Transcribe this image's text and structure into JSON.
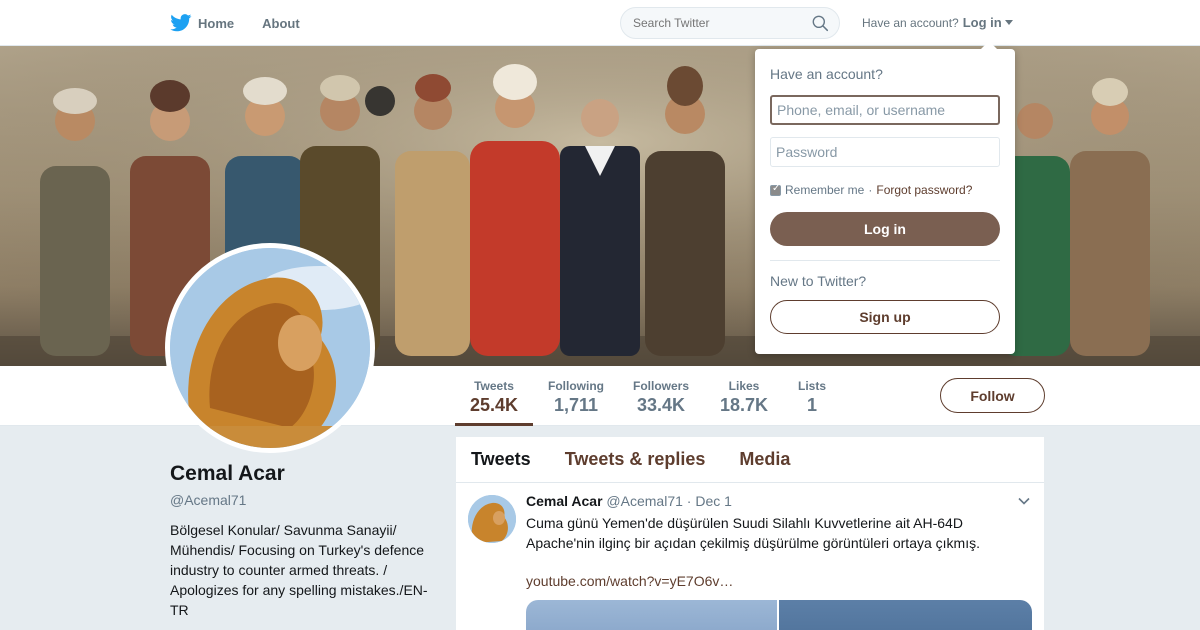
{
  "nav": {
    "home_label": "Home",
    "about_label": "About",
    "search_placeholder": "Search Twitter",
    "have_account_text": "Have an account?",
    "login_label": "Log in"
  },
  "profile": {
    "name": "Cemal Acar",
    "handle": "@Acemal71",
    "bio": "Bölgesel Konular/ Savunma Sanayii/ Mühendis/ Focusing on Turkey's defence industry to counter armed threats. / Apologizes for any spelling mistakes./EN-TR"
  },
  "stats": [
    {
      "label": "Tweets",
      "value": "25.4K"
    },
    {
      "label": "Following",
      "value": "1,711"
    },
    {
      "label": "Followers",
      "value": "33.4K"
    },
    {
      "label": "Likes",
      "value": "18.7K"
    },
    {
      "label": "Lists",
      "value": "1"
    }
  ],
  "follow_label": "Follow",
  "timeline": {
    "tabs": [
      "Tweets",
      "Tweets & replies",
      "Media"
    ],
    "tweet": {
      "name": "Cemal Acar",
      "handle": "@Acemal71",
      "date": "· Dec 1",
      "text": "Cuma günü Yemen'de düşürülen Suudi Silahlı Kuvvetlerine ait AH-64D Apache'nin ilginç bir açıdan çekilmiş düşürülme görüntüleri ortaya çıkmış.",
      "link": "youtube.com/watch?v=yE7O6v…"
    }
  },
  "login_dropdown": {
    "title": "Have an account?",
    "username_placeholder": "Phone, email, or username",
    "password_placeholder": "Password",
    "remember_label": "Remember me",
    "separator": "·",
    "forgot_label": "Forgot password?",
    "login_button": "Log in",
    "new_text": "New to Twitter?",
    "signup_button": "Sign up"
  },
  "colors": {
    "accent": "#5e3d2e",
    "login_button": "#7a5f51",
    "twitter_blue": "#1da1f2",
    "page_bg": "#e6ecf0"
  }
}
